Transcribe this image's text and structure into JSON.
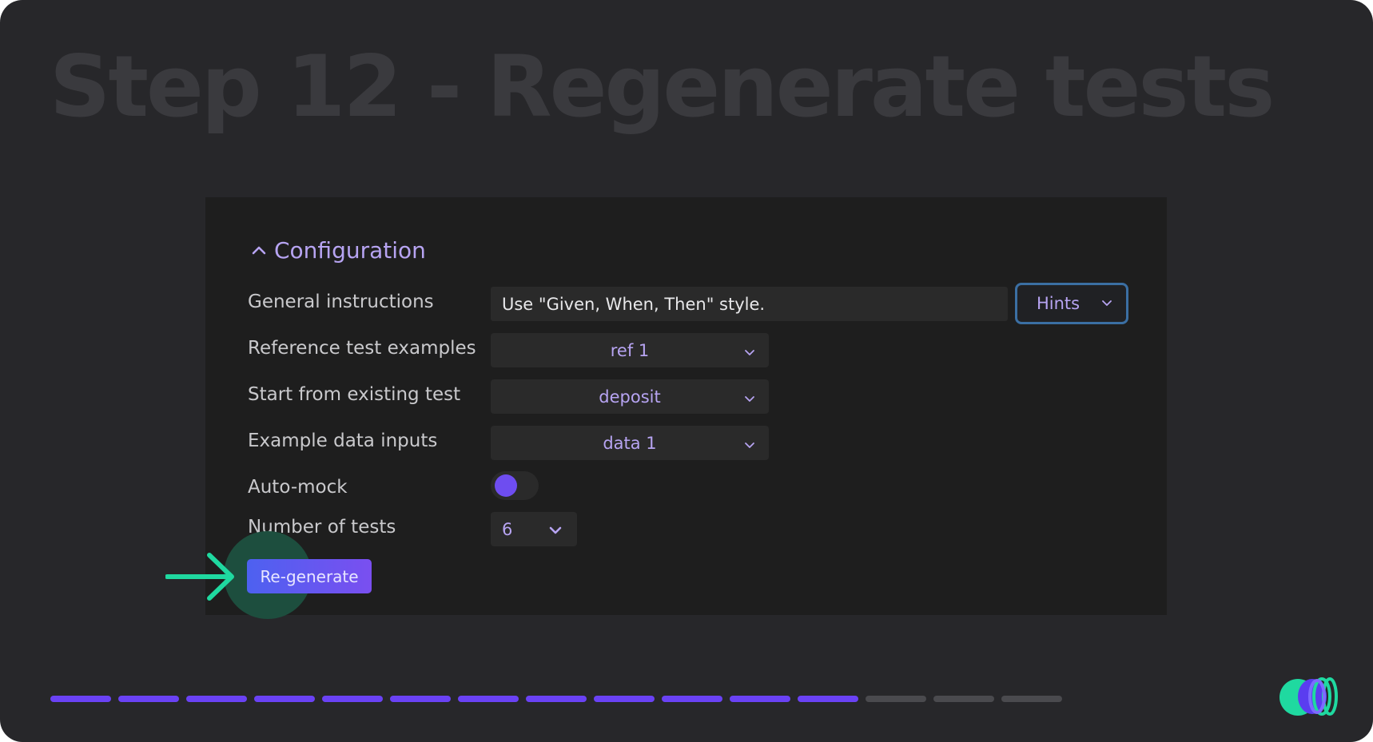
{
  "headline": "Step 12 - Regenerate tests",
  "config": {
    "section_title": "Configuration",
    "general_instructions": {
      "label": "General instructions",
      "value": "Use \"Given, When, Then\" style.",
      "hints_label": "Hints"
    },
    "reference_test_examples": {
      "label": "Reference test examples",
      "value": "ref 1"
    },
    "start_from_existing_test": {
      "label": "Start from existing test",
      "value": "deposit"
    },
    "example_data_inputs": {
      "label": "Example data inputs",
      "value": "data 1"
    },
    "auto_mock": {
      "label": "Auto-mock",
      "enabled": true
    },
    "number_of_tests": {
      "label": "Number of tests",
      "value": "6"
    },
    "regenerate_button": "Re-generate"
  },
  "progress": {
    "current_step": 12,
    "total_steps": 15
  },
  "colors": {
    "accent": "#6e4df0",
    "label_purple": "#b7a4f2",
    "arrow_green": "#1fd9a0",
    "progress_done": "#6a42f5",
    "progress_todo": "#4a4a4e"
  }
}
